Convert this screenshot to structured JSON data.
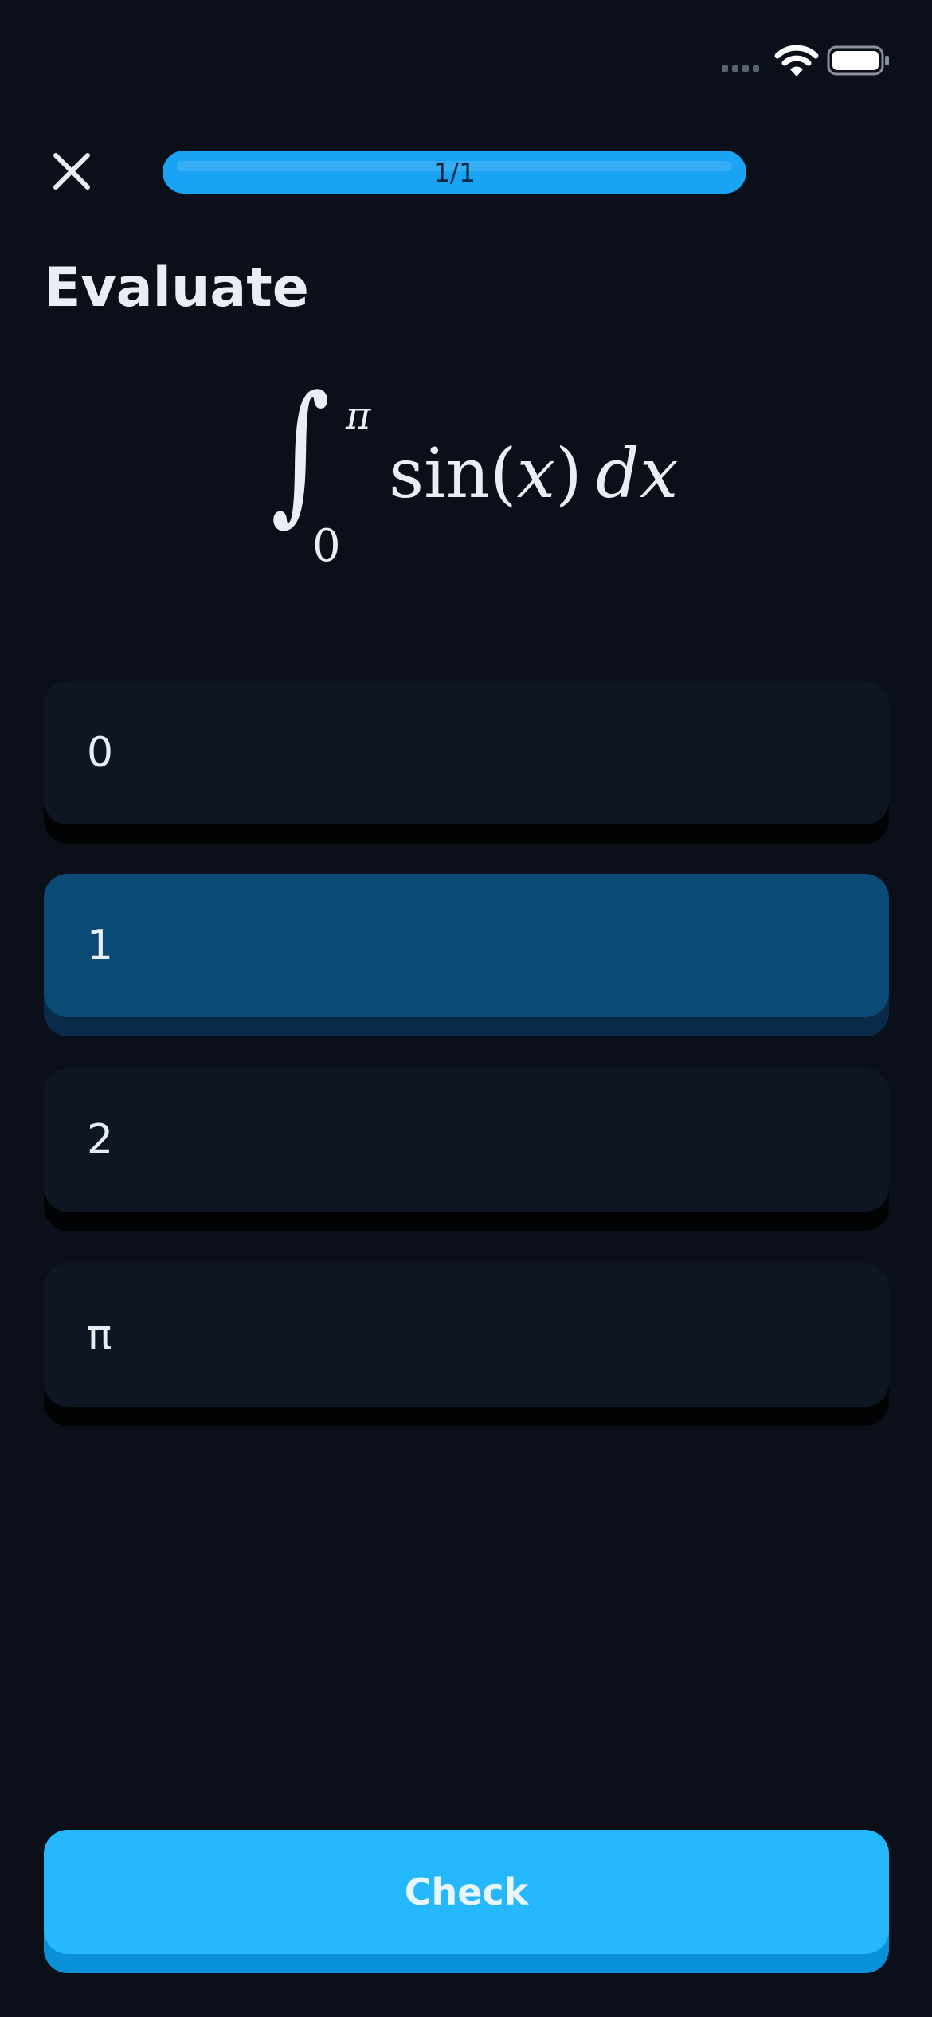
{
  "status_bar": {
    "icons": [
      "cellular-signal-icon",
      "wifi-icon",
      "battery-icon"
    ]
  },
  "header": {
    "close_icon": "close-icon",
    "progress": {
      "label": "1/1",
      "fraction": 1.0
    }
  },
  "prompt": {
    "title": "Evaluate"
  },
  "formula": {
    "integral_symbol": "∫",
    "upper_limit": "π",
    "lower_limit": "0",
    "function_name": "sin",
    "open_paren": "(",
    "variable": "x",
    "close_paren": ")",
    "differential": "dx"
  },
  "options": [
    {
      "label": "0",
      "selected": false
    },
    {
      "label": "1",
      "selected": true
    },
    {
      "label": "2",
      "selected": false
    },
    {
      "label": "π",
      "selected": false
    }
  ],
  "check_button": {
    "label": "Check"
  },
  "colors": {
    "background": "#0a0f1a",
    "card": "#0e1623",
    "card_selected": "#0a4a74",
    "accent": "#26b8ff",
    "text": "#e8edf6"
  }
}
